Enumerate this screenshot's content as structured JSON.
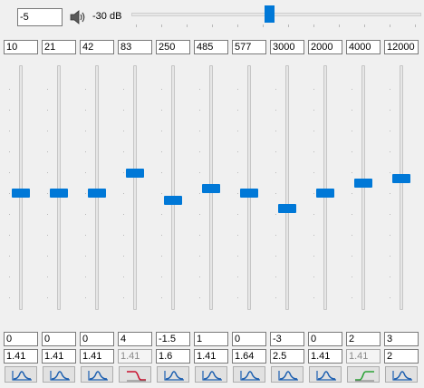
{
  "preamp": {
    "value": "-5",
    "volume_label": "-30 dB",
    "speaker_icon": "speaker-icon",
    "volume_level_fraction": 0.48
  },
  "bands": [
    {
      "freq": "10",
      "gain": "0",
      "q": "1.41",
      "q_disabled": false,
      "filter": "peak",
      "level_db": 0
    },
    {
      "freq": "21",
      "gain": "0",
      "q": "1.41",
      "q_disabled": false,
      "filter": "peak",
      "level_db": 0
    },
    {
      "freq": "42",
      "gain": "0",
      "q": "1.41",
      "q_disabled": false,
      "filter": "peak",
      "level_db": 0
    },
    {
      "freq": "83",
      "gain": "4",
      "q": "1.41",
      "q_disabled": true,
      "filter": "low-shelf",
      "level_db": 4
    },
    {
      "freq": "250",
      "gain": "-1.5",
      "q": "1.6",
      "q_disabled": false,
      "filter": "peak",
      "level_db": -1.5
    },
    {
      "freq": "485",
      "gain": "1",
      "q": "1.41",
      "q_disabled": false,
      "filter": "peak",
      "level_db": 1
    },
    {
      "freq": "577",
      "gain": "0",
      "q": "1.64",
      "q_disabled": false,
      "filter": "peak",
      "level_db": 0
    },
    {
      "freq": "3000",
      "gain": "-3",
      "q": "2.5",
      "q_disabled": false,
      "filter": "peak",
      "level_db": -3
    },
    {
      "freq": "2000",
      "gain": "0",
      "q": "1.41",
      "q_disabled": false,
      "filter": "peak",
      "level_db": 0
    },
    {
      "freq": "4000",
      "gain": "2",
      "q": "1.41",
      "q_disabled": true,
      "filter": "high-shelf",
      "level_db": 2
    },
    {
      "freq": "12000",
      "gain": "3",
      "q": "2",
      "q_disabled": false,
      "filter": "peak",
      "level_db": 3
    }
  ],
  "colors": {
    "accent": "#0078d7",
    "peak_icon": "#1c5fb0",
    "low_shelf_icon": "#c8102e",
    "high_shelf_icon": "#2aa336"
  }
}
